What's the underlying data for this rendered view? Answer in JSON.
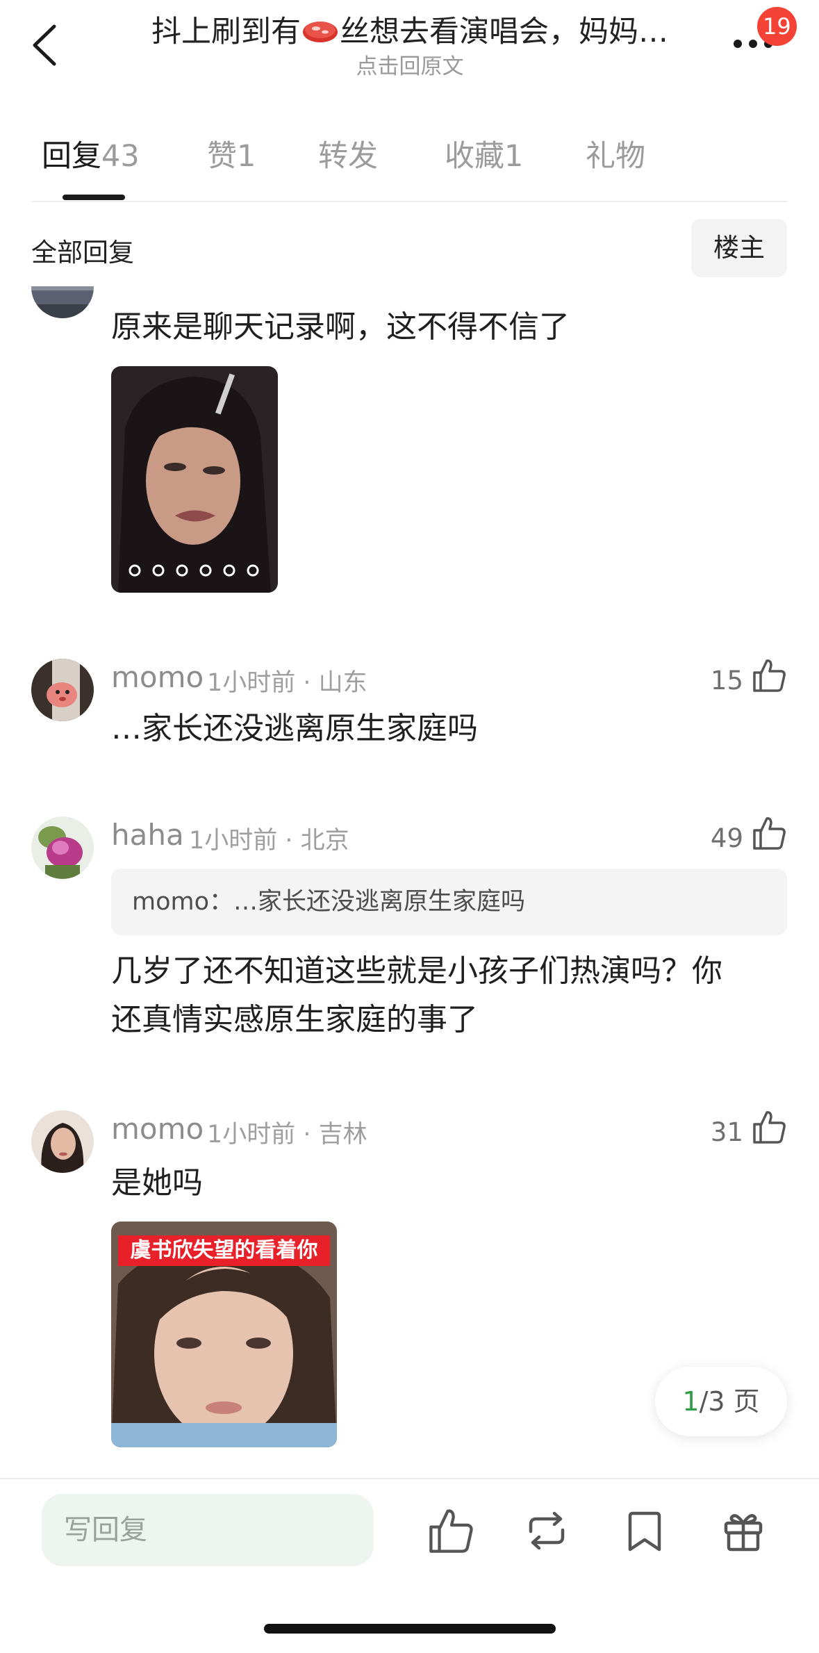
{
  "header": {
    "title_before": "抖上刷到有",
    "title_after": "丝想去看演唱会，妈妈…",
    "subtitle": "点击回原文",
    "notification_count": "19"
  },
  "tabs": [
    {
      "label": "回复",
      "count": "43",
      "active": true
    },
    {
      "label": "赞",
      "count": "1",
      "active": false
    },
    {
      "label": "转发",
      "count": "",
      "active": false
    },
    {
      "label": "收藏",
      "count": "1",
      "active": false
    },
    {
      "label": "礼物",
      "count": "",
      "active": false
    }
  ],
  "filter": {
    "all_replies": "全部回复",
    "op_only": "楼主"
  },
  "comments": [
    {
      "text": "原来是聊天记录啊，这不得不信了",
      "image": "gif-thumbnail"
    },
    {
      "user": "momo",
      "meta": "1小时前 · 山东",
      "likes": "15",
      "text": "…家长还没逃离原生家庭吗"
    },
    {
      "user": "haha",
      "meta": "1小时前 · 北京",
      "likes": "49",
      "quote": "momo：…家长还没逃离原生家庭吗",
      "text_line1": "几岁了还不知道这些就是小孩子们热演吗？你",
      "text_line2": "还真情实感原生家庭的事了"
    },
    {
      "user": "momo",
      "meta": "1小时前 · 吉林",
      "likes": "31",
      "text": "是她吗",
      "image_caption": "虞书欣失望的看着你"
    }
  ],
  "pager": {
    "current": "1",
    "total_suffix": "/3 页"
  },
  "bottom_bar": {
    "reply_placeholder": "写回复"
  },
  "colors": {
    "badge": "#f44336",
    "pager_current": "#2f9e44",
    "input_bg": "#eef5f1"
  }
}
